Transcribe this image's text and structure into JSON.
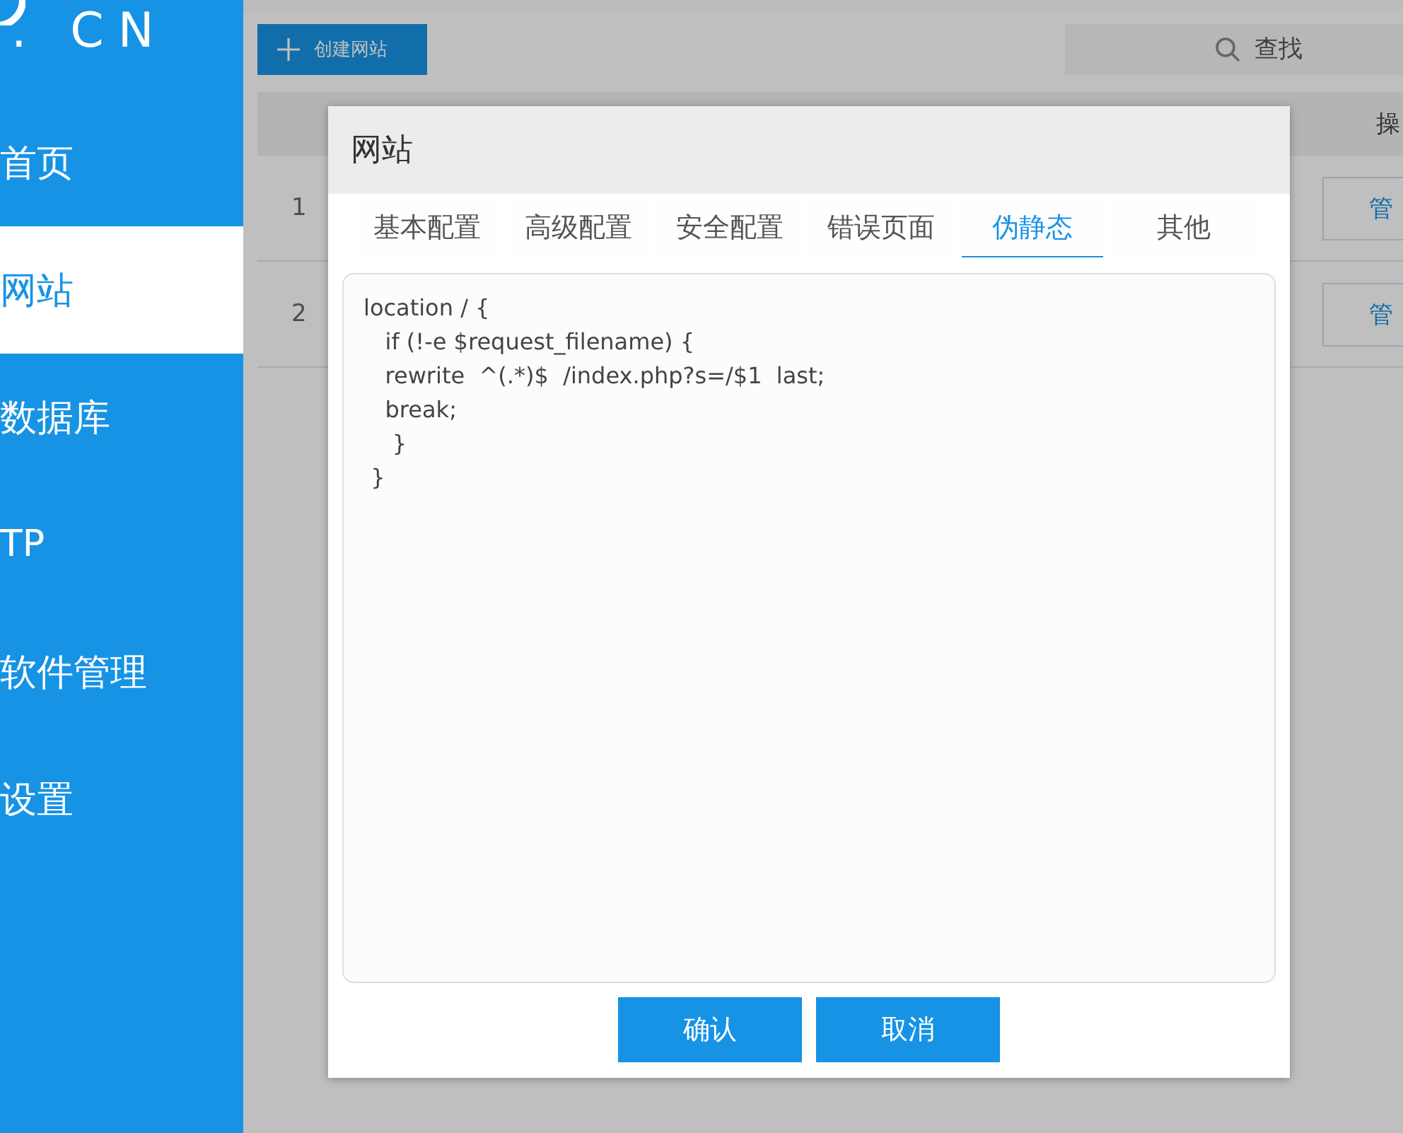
{
  "sidebar": {
    "logo_text": ". CN",
    "items": [
      {
        "label": "首页",
        "selected": false
      },
      {
        "label": "网站",
        "selected": true
      },
      {
        "label": "数据库",
        "selected": false
      },
      {
        "label": "TP",
        "selected": false
      },
      {
        "label": "软件管理",
        "selected": false
      },
      {
        "label": "设置",
        "selected": false
      }
    ]
  },
  "toolbar": {
    "create_button": "创建网站",
    "search": {
      "placeholder": "查找"
    }
  },
  "table": {
    "header": "操",
    "rows": [
      {
        "index": "1",
        "action": "管"
      },
      {
        "index": "2",
        "action": "管"
      }
    ]
  },
  "dialog": {
    "title": "网站",
    "tabs": [
      {
        "label": "基本配置",
        "selected": false
      },
      {
        "label": "高级配置",
        "selected": false
      },
      {
        "label": "安全配置",
        "selected": false
      },
      {
        "label": "错误页面",
        "selected": false
      },
      {
        "label": "伪静态",
        "selected": true
      },
      {
        "label": "其他",
        "selected": false
      }
    ],
    "code": "location / {\n   if (!-e $request_filename) {\n   rewrite  ^(.*)$  /index.php?s=/$1  last;\n   break;\n    }\n }",
    "buttons": [
      "确认",
      "取消"
    ]
  }
}
